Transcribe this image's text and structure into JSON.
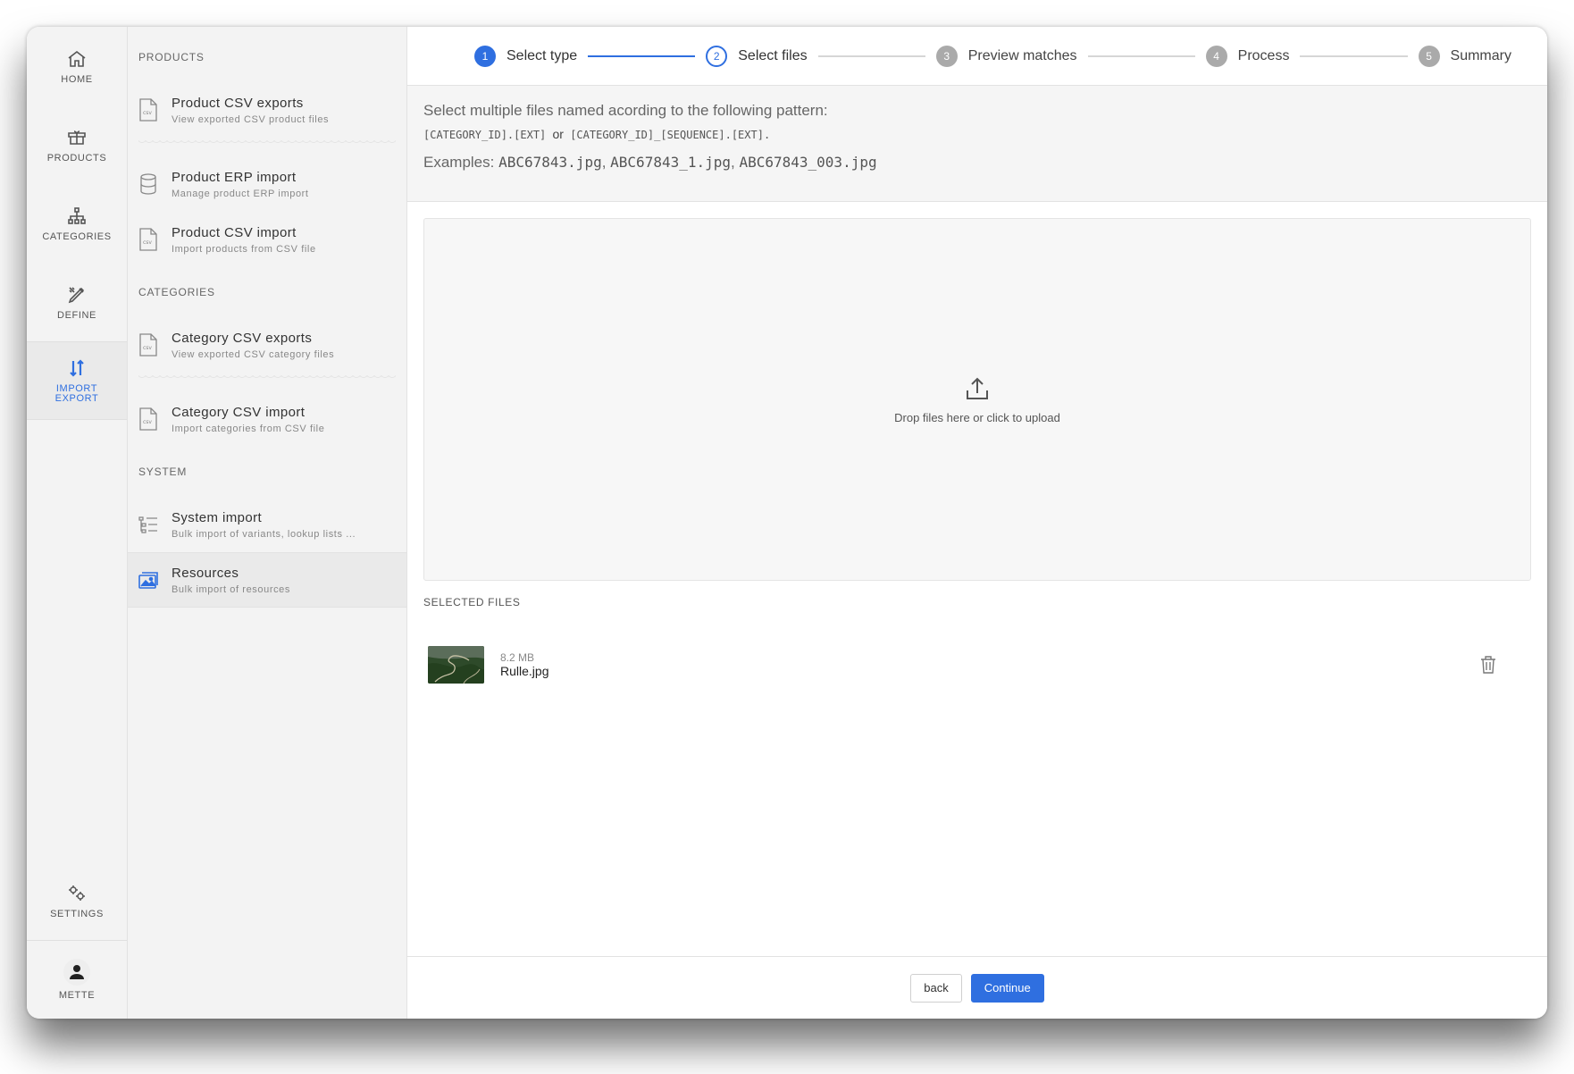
{
  "rail": {
    "home": "HOME",
    "products": "PRODUCTS",
    "categories": "CATEGORIES",
    "define": "DEFINE",
    "import_export_line1": "IMPORT",
    "import_export_line2": "EXPORT",
    "settings": "SETTINGS",
    "user": "METTE"
  },
  "subnav": {
    "products_title": "PRODUCTS",
    "product_csv_exports": {
      "title": "Product CSV exports",
      "subtitle": "View exported CSV product files"
    },
    "product_erp_import": {
      "title": "Product ERP import",
      "subtitle": "Manage product ERP import"
    },
    "product_csv_import": {
      "title": "Product CSV import",
      "subtitle": "Import products from CSV file"
    },
    "categories_title": "CATEGORIES",
    "category_csv_exports": {
      "title": "Category CSV exports",
      "subtitle": "View exported CSV category files"
    },
    "category_csv_import": {
      "title": "Category CSV import",
      "subtitle": "Import categories from CSV file"
    },
    "system_title": "SYSTEM",
    "system_import": {
      "title": "System import",
      "subtitle": "Bulk import of variants, lookup lists ..."
    },
    "resources": {
      "title": "Resources",
      "subtitle": "Bulk import of resources"
    }
  },
  "stepper": {
    "steps": [
      {
        "num": "1",
        "label": "Select type"
      },
      {
        "num": "2",
        "label": "Select files"
      },
      {
        "num": "3",
        "label": "Preview matches"
      },
      {
        "num": "4",
        "label": "Process"
      },
      {
        "num": "5",
        "label": "Summary"
      }
    ]
  },
  "info": {
    "line1": "Select multiple files named acording to the following pattern:",
    "pattern1": "[CATEGORY_ID].[EXT]",
    "or": "or",
    "pattern2": "[CATEGORY_ID]_[SEQUENCE].[EXT].",
    "examples_label": "Examples:",
    "example1": "ABC67843.jpg",
    "example2": "ABC67843_1.jpg",
    "example3": "ABC67843_003.jpg"
  },
  "dropzone": {
    "text": "Drop files here or click to upload"
  },
  "selected": {
    "title": "SELECTED FILES",
    "files": [
      {
        "size": "8.2 MB",
        "name": "Rulle.jpg"
      }
    ]
  },
  "footer": {
    "back": "back",
    "continue": "Continue"
  },
  "colors": {
    "accent": "#2f6fe0",
    "rail_bg": "#f3f3f3"
  }
}
